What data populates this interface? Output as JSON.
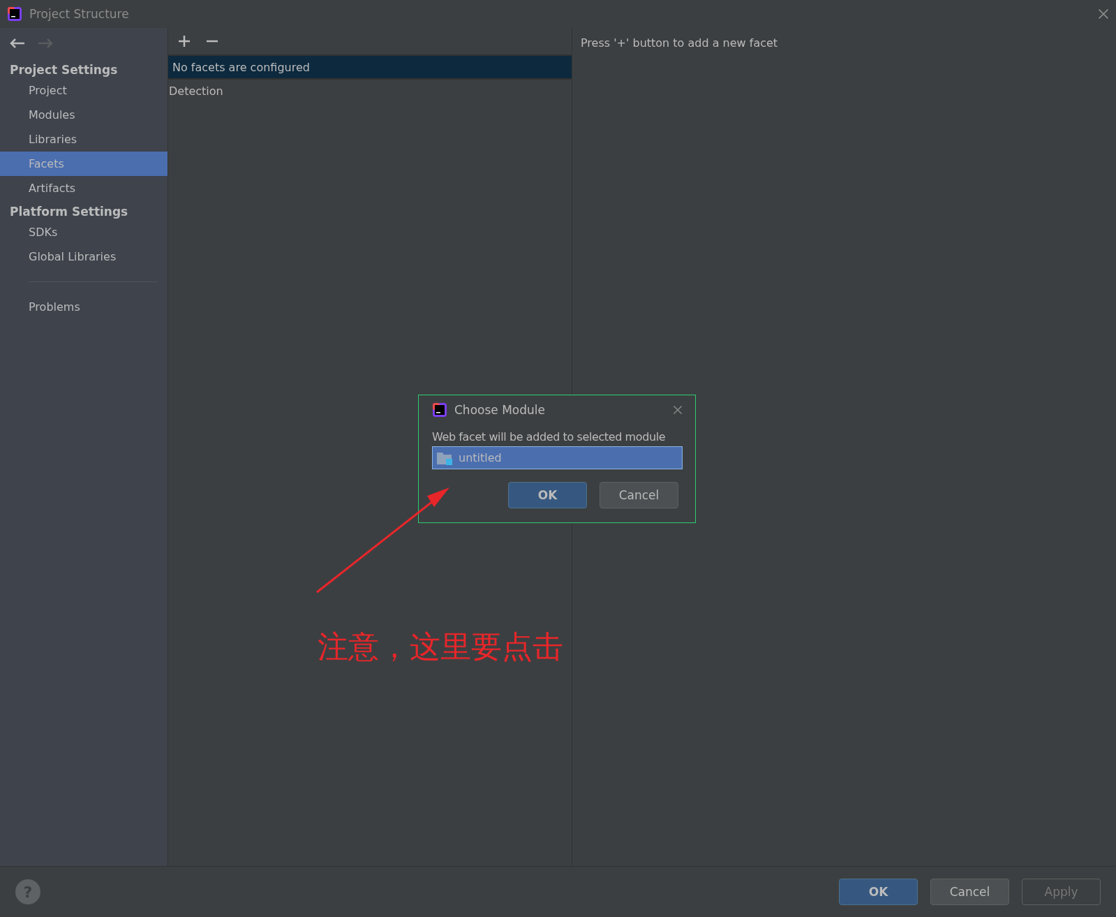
{
  "window": {
    "title": "Project Structure"
  },
  "sidebar": {
    "groups": [
      {
        "heading": "Project Settings",
        "items": [
          {
            "label": "Project",
            "selected": false
          },
          {
            "label": "Modules",
            "selected": false
          },
          {
            "label": "Libraries",
            "selected": false
          },
          {
            "label": "Facets",
            "selected": true
          },
          {
            "label": "Artifacts",
            "selected": false
          }
        ]
      },
      {
        "heading": "Platform Settings",
        "items": [
          {
            "label": "SDKs",
            "selected": false
          },
          {
            "label": "Global Libraries",
            "selected": false
          }
        ]
      }
    ],
    "footer_items": [
      {
        "label": "Problems",
        "selected": false
      }
    ]
  },
  "facets_list": {
    "rows": [
      {
        "label": "No facets are configured",
        "selected": true
      },
      {
        "label": "Detection",
        "selected": false
      }
    ]
  },
  "detail": {
    "hint": "Press '+' button to add a new facet"
  },
  "dialog": {
    "title": "Choose Module",
    "message": "Web facet will be added to selected module",
    "modules": [
      {
        "label": "untitled",
        "selected": true
      }
    ],
    "buttons": [
      {
        "label": "OK",
        "primary": true
      },
      {
        "label": "Cancel",
        "primary": false
      }
    ]
  },
  "annotation": {
    "text": "注意，这里要点击"
  },
  "footer": {
    "help": "?",
    "buttons": [
      {
        "label": "OK",
        "primary": true,
        "disabled": false
      },
      {
        "label": "Cancel",
        "primary": false,
        "disabled": false
      },
      {
        "label": "Apply",
        "primary": false,
        "disabled": true
      }
    ]
  }
}
